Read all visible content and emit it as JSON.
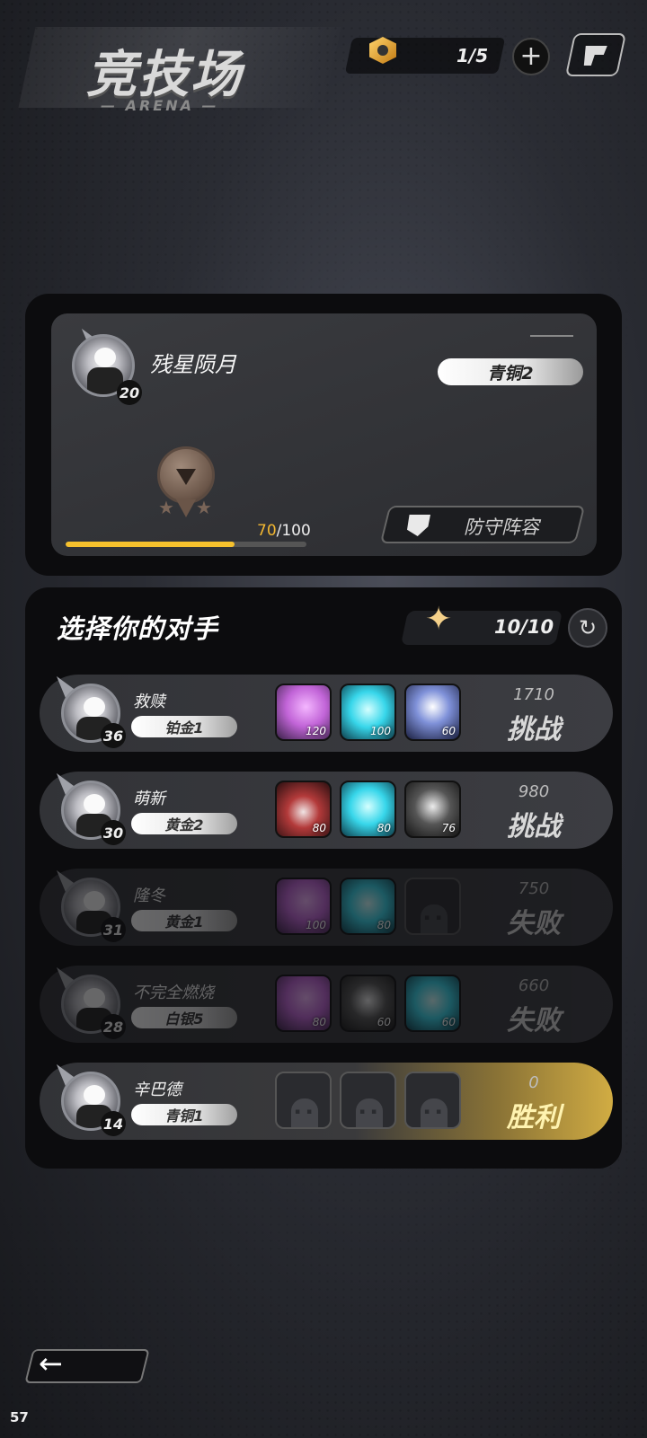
{
  "header": {
    "title": "竞技场",
    "subtitle": "— ARENA —",
    "ticket_count": "1/5",
    "add_label": "+"
  },
  "player": {
    "name": "残星陨月",
    "level": "20",
    "rank": "青铜2",
    "progress_current": "70",
    "progress_max": "/100",
    "progress_fraction": 0.7,
    "defense_label": "防守阵容"
  },
  "opponents_section": {
    "title": "选择你的对手",
    "attempts": "10/10"
  },
  "opponents": [
    {
      "name": "救赎",
      "level": "36",
      "rank": "铂金1",
      "score": "1710",
      "action": "挑战",
      "state": "active",
      "heroes": [
        {
          "color": "purple",
          "lv": "120"
        },
        {
          "color": "cyan",
          "lv": "100"
        },
        {
          "color": "blue",
          "lv": "60"
        }
      ]
    },
    {
      "name": "萌新",
      "level": "30",
      "rank": "黄金2",
      "score": "980",
      "action": "挑战",
      "state": "active",
      "heroes": [
        {
          "color": "red",
          "lv": "80"
        },
        {
          "color": "cyan",
          "lv": "80"
        },
        {
          "color": "dark",
          "lv": "76"
        }
      ]
    },
    {
      "name": "隆冬",
      "level": "31",
      "rank": "黄金1",
      "score": "750",
      "action": "失败",
      "state": "dim",
      "heroes": [
        {
          "color": "purple",
          "lv": "100"
        },
        {
          "color": "cyan",
          "lv": "80"
        },
        {
          "color": "empty",
          "lv": ""
        }
      ]
    },
    {
      "name": "不完全燃烧",
      "level": "28",
      "rank": "白银5",
      "score": "660",
      "action": "失败",
      "state": "dim",
      "heroes": [
        {
          "color": "purple",
          "lv": "80"
        },
        {
          "color": "dark",
          "lv": "60"
        },
        {
          "color": "cyan",
          "lv": "60"
        }
      ]
    },
    {
      "name": "辛巴德",
      "level": "14",
      "rank": "青铜1",
      "score": "0",
      "action": "胜利",
      "state": "win",
      "heroes": [
        {
          "color": "empty",
          "lv": ""
        },
        {
          "color": "empty",
          "lv": ""
        },
        {
          "color": "empty",
          "lv": ""
        }
      ]
    }
  ],
  "footer": {
    "back_icon": "←",
    "fps": "57"
  },
  "colors": {
    "progress": "#f6c12d",
    "win_gold": "#d1ac43"
  }
}
